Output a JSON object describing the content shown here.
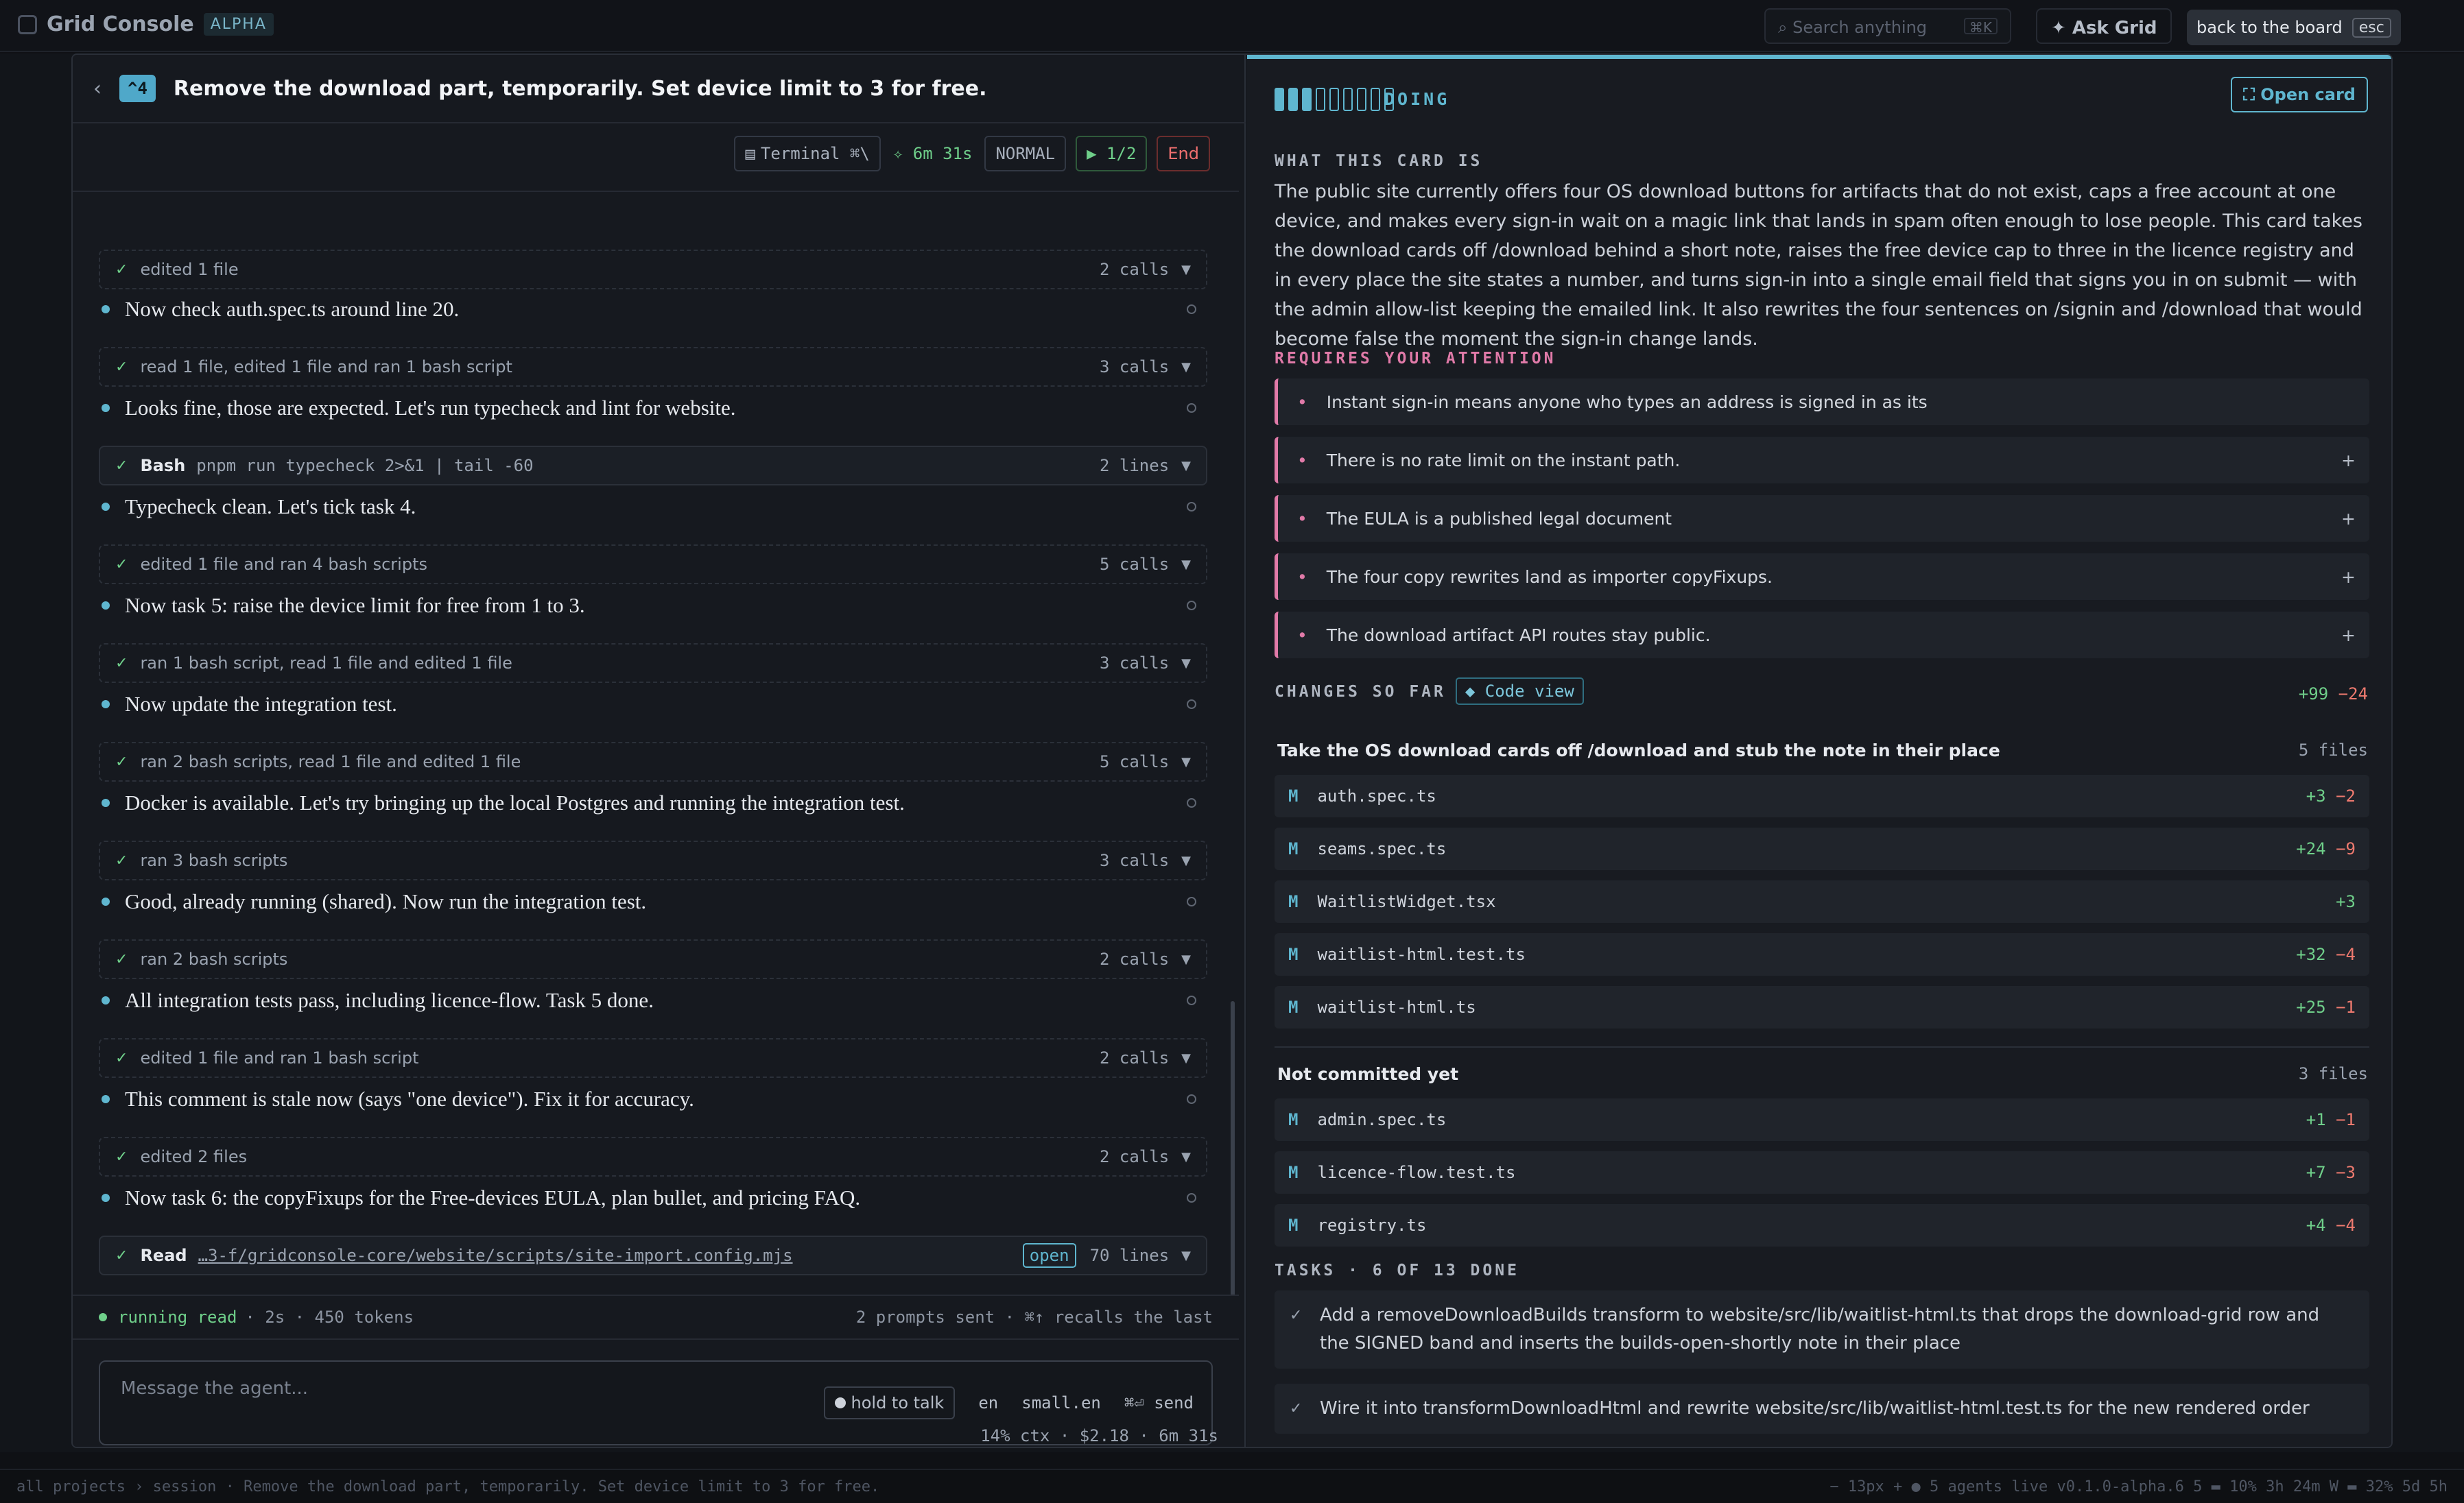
{
  "app": {
    "name": "Grid Console",
    "tag": "ALPHA",
    "search_placeholder": "Search anything",
    "search_kbd": "⌘K",
    "ask": "Ask Grid",
    "back": "back to the board",
    "back_kbd": "esc"
  },
  "status_bar": {
    "left": "all projects › session · Remove the download part, temporarily. Set device limit to 3 for free.",
    "right": "−   13px   +    ● 5 agents live   v0.1.0-alpha.6   5 ▬ 10%  3h 24m  W ▬ 32%  5d 5h"
  },
  "session": {
    "badge": "^4",
    "title": "Remove the download part, temporarily. Set device limit to 3 for free.",
    "toolbar": {
      "terminal": "Terminal ⌘\\",
      "elapsed": "✧ 6m 31s",
      "mode": "NORMAL",
      "step": "▶ 1/2",
      "end": "End"
    },
    "feed": [
      {
        "kind": "tool",
        "text": "edited 1 file",
        "count": "2 calls"
      },
      {
        "kind": "msg",
        "text": "Now check auth.spec.ts around line 20."
      },
      {
        "kind": "tool",
        "text": "read 1 file, edited 1 file and ran 1 bash script",
        "count": "3 calls"
      },
      {
        "kind": "msg",
        "text": "Looks fine, those are expected. Let's run typecheck and lint for website."
      },
      {
        "kind": "bash",
        "label": "Bash",
        "text": "pnpm run typecheck 2>&1 | tail -60",
        "count": "2 lines"
      },
      {
        "kind": "msg",
        "text": "Typecheck clean. Let's tick task 4."
      },
      {
        "kind": "tool",
        "text": "edited 1 file and ran 4 bash scripts",
        "count": "5 calls"
      },
      {
        "kind": "msg",
        "text": "Now task 5: raise the device limit for free from 1 to 3."
      },
      {
        "kind": "tool",
        "text": "ran 1 bash script, read 1 file and edited 1 file",
        "count": "3 calls"
      },
      {
        "kind": "msg",
        "text": "Now update the integration test."
      },
      {
        "kind": "tool",
        "text": "ran 2 bash scripts, read 1 file and edited 1 file",
        "count": "5 calls"
      },
      {
        "kind": "msg",
        "text": "Docker is available. Let's try bringing up the local Postgres and running the integration test."
      },
      {
        "kind": "tool",
        "text": "ran 3 bash scripts",
        "count": "3 calls"
      },
      {
        "kind": "msg",
        "text": "Good, already running (shared). Now run the integration test."
      },
      {
        "kind": "tool",
        "text": "ran 2 bash scripts",
        "count": "2 calls"
      },
      {
        "kind": "msg",
        "text": "All integration tests pass, including licence-flow. Task 5 done."
      },
      {
        "kind": "tool",
        "text": "edited 1 file and ran 1 bash script",
        "count": "2 calls"
      },
      {
        "kind": "msg",
        "text": "This comment is stale now (says \"one device\"). Fix it for accuracy."
      },
      {
        "kind": "tool",
        "text": "edited 2 files",
        "count": "2 calls"
      },
      {
        "kind": "msg",
        "text": "Now task 6: the copyFixups for the Free-devices EULA, plan bullet, and pricing FAQ."
      },
      {
        "kind": "read",
        "label": "Read",
        "text": "…3-f/gridconsole-core/website/scripts/site-import.config.mjs",
        "open": "open",
        "count": "70 lines"
      }
    ],
    "running": {
      "state": "running read",
      "detail": "· 2s · 450 tokens",
      "right": "2 prompts sent · ⌘↑ recalls the last"
    },
    "composer": {
      "placeholder": "Message the agent...",
      "hold": "hold to talk",
      "lang": "en",
      "model": "small.en",
      "send": "⌘⏎ send"
    },
    "footer": "14% ctx · $2.18 · 6m 31s"
  },
  "card": {
    "status": "DOING",
    "progress_done": 3,
    "progress_total": 9,
    "open_card": "⛶ Open card",
    "what_heading": "WHAT THIS CARD IS",
    "what_text": "The public site currently offers four OS download buttons for artifacts that do not exist, caps a free account at one device, and makes every sign-in wait on a magic link that lands in spam often enough to lose people. This card takes the download cards off /download behind a short note, raises the free device cap to three in the licence registry and in every place the site states a number, and turns sign-in into a single email field that signs you in on submit — with the admin allow-list keeping the emailed link. It also rewrites the four sentences on /signin and /download that would become false the moment the sign-in change lands.",
    "attention_heading": "REQUIRES YOUR ATTENTION",
    "attention": [
      {
        "text": "Instant sign-in means anyone who types an address is signed in as its",
        "plus": ""
      },
      {
        "text": "There is no rate limit on the instant path.",
        "plus": "+"
      },
      {
        "text": "The EULA is a published legal document",
        "plus": "+"
      },
      {
        "text": "The four copy rewrites land as importer copyFixups.",
        "plus": "+"
      },
      {
        "text": "The download artifact API routes stay public.",
        "plus": "+"
      }
    ],
    "changes_heading": "CHANGES SO FAR",
    "code_view": "◆ Code view",
    "changes_add": "+99",
    "changes_del": "−24",
    "groups": [
      {
        "title": "Take the OS download cards off /download and stub the note in their place",
        "count": "5 files",
        "files": [
          {
            "m": "M",
            "name": "auth.spec.ts",
            "add": "+3",
            "del": "−2"
          },
          {
            "m": "M",
            "name": "seams.spec.ts",
            "add": "+24",
            "del": "−9"
          },
          {
            "m": "M",
            "name": "WaitlistWidget.tsx",
            "add": "+3",
            "del": ""
          },
          {
            "m": "M",
            "name": "waitlist-html.test.ts",
            "add": "+32",
            "del": "−4"
          },
          {
            "m": "M",
            "name": "waitlist-html.ts",
            "add": "+25",
            "del": "−1"
          }
        ]
      },
      {
        "title": "Not committed yet",
        "count": "3 files",
        "files": [
          {
            "m": "M",
            "name": "admin.spec.ts",
            "add": "+1",
            "del": "−1"
          },
          {
            "m": "M",
            "name": "licence-flow.test.ts",
            "add": "+7",
            "del": "−3"
          },
          {
            "m": "M",
            "name": "registry.ts",
            "add": "+4",
            "del": "−4"
          }
        ]
      }
    ],
    "tasks_heading": "TASKS · 6 OF 13 DONE",
    "tasks": [
      "Add a removeDownloadBuilds transform to website/src/lib/waitlist-html.ts that drops the download-grid row and the SIGNED band and inserts the builds-open-shortly note in their place",
      "Wire it into transformDownloadHtml and rewrite website/src/lib/waitlist-html.test.ts for the new rendered order"
    ]
  }
}
